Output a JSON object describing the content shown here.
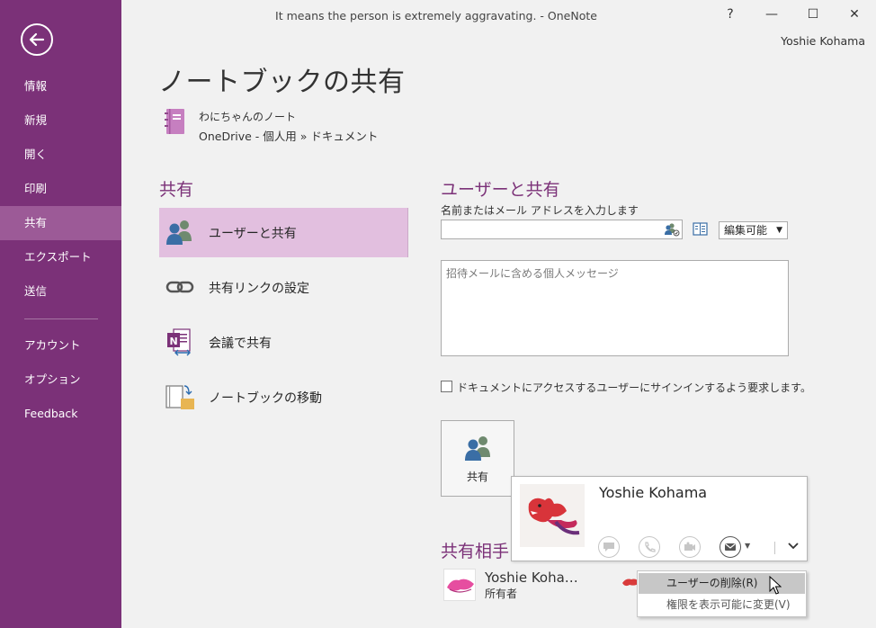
{
  "window": {
    "title": "It means the person is extremely aggravating. - OneNote",
    "help": "?",
    "minimize": "—",
    "restore": "☐",
    "close": "✕",
    "user": "Yoshie Kohama"
  },
  "sidebar": {
    "items": [
      {
        "label": "情報"
      },
      {
        "label": "新規"
      },
      {
        "label": "開く"
      },
      {
        "label": "印刷"
      },
      {
        "label": "共有"
      },
      {
        "label": "エクスポート"
      },
      {
        "label": "送信"
      },
      {
        "label": "アカウント"
      },
      {
        "label": "オプション"
      },
      {
        "label": "Feedback"
      }
    ],
    "selected": "共有"
  },
  "page": {
    "title": "ノートブックの共有",
    "notebook_name": "わにちゃんのノート",
    "notebook_path": "OneDrive - 個人用 » ドキュメント"
  },
  "share_panel": {
    "heading": "共有",
    "options": [
      {
        "label": "ユーザーと共有",
        "icon": "people-icon"
      },
      {
        "label": "共有リンクの設定",
        "icon": "link-icon"
      },
      {
        "label": "会議で共有",
        "icon": "onenote-meeting-icon"
      },
      {
        "label": "ノートブックの移動",
        "icon": "move-notebook-icon"
      }
    ]
  },
  "share_form": {
    "heading": "ユーザーと共有",
    "name_label": "名前またはメール アドレスを入力します",
    "name_value": "",
    "permission": "編集可能",
    "message_placeholder": "招待メールに含める個人メッセージ",
    "signin_label": "ドキュメントにアクセスするユーザーにサインインするよう要求します。",
    "signin_checked": false,
    "share_button": "共有"
  },
  "shared_with": {
    "heading": "共有相手",
    "users": [
      {
        "name": "Yoshie Koha…",
        "role": "所有者"
      }
    ]
  },
  "contact_card": {
    "name": "Yoshie Kohama"
  },
  "context_menu": {
    "items": [
      {
        "label": "ユーザーの削除(R)"
      },
      {
        "label": "権限を表示可能に変更(V)"
      }
    ]
  },
  "colors": {
    "accent": "#7b3178",
    "selected_nav": "#9c5a97",
    "selected_option": "#e2bfdf"
  }
}
